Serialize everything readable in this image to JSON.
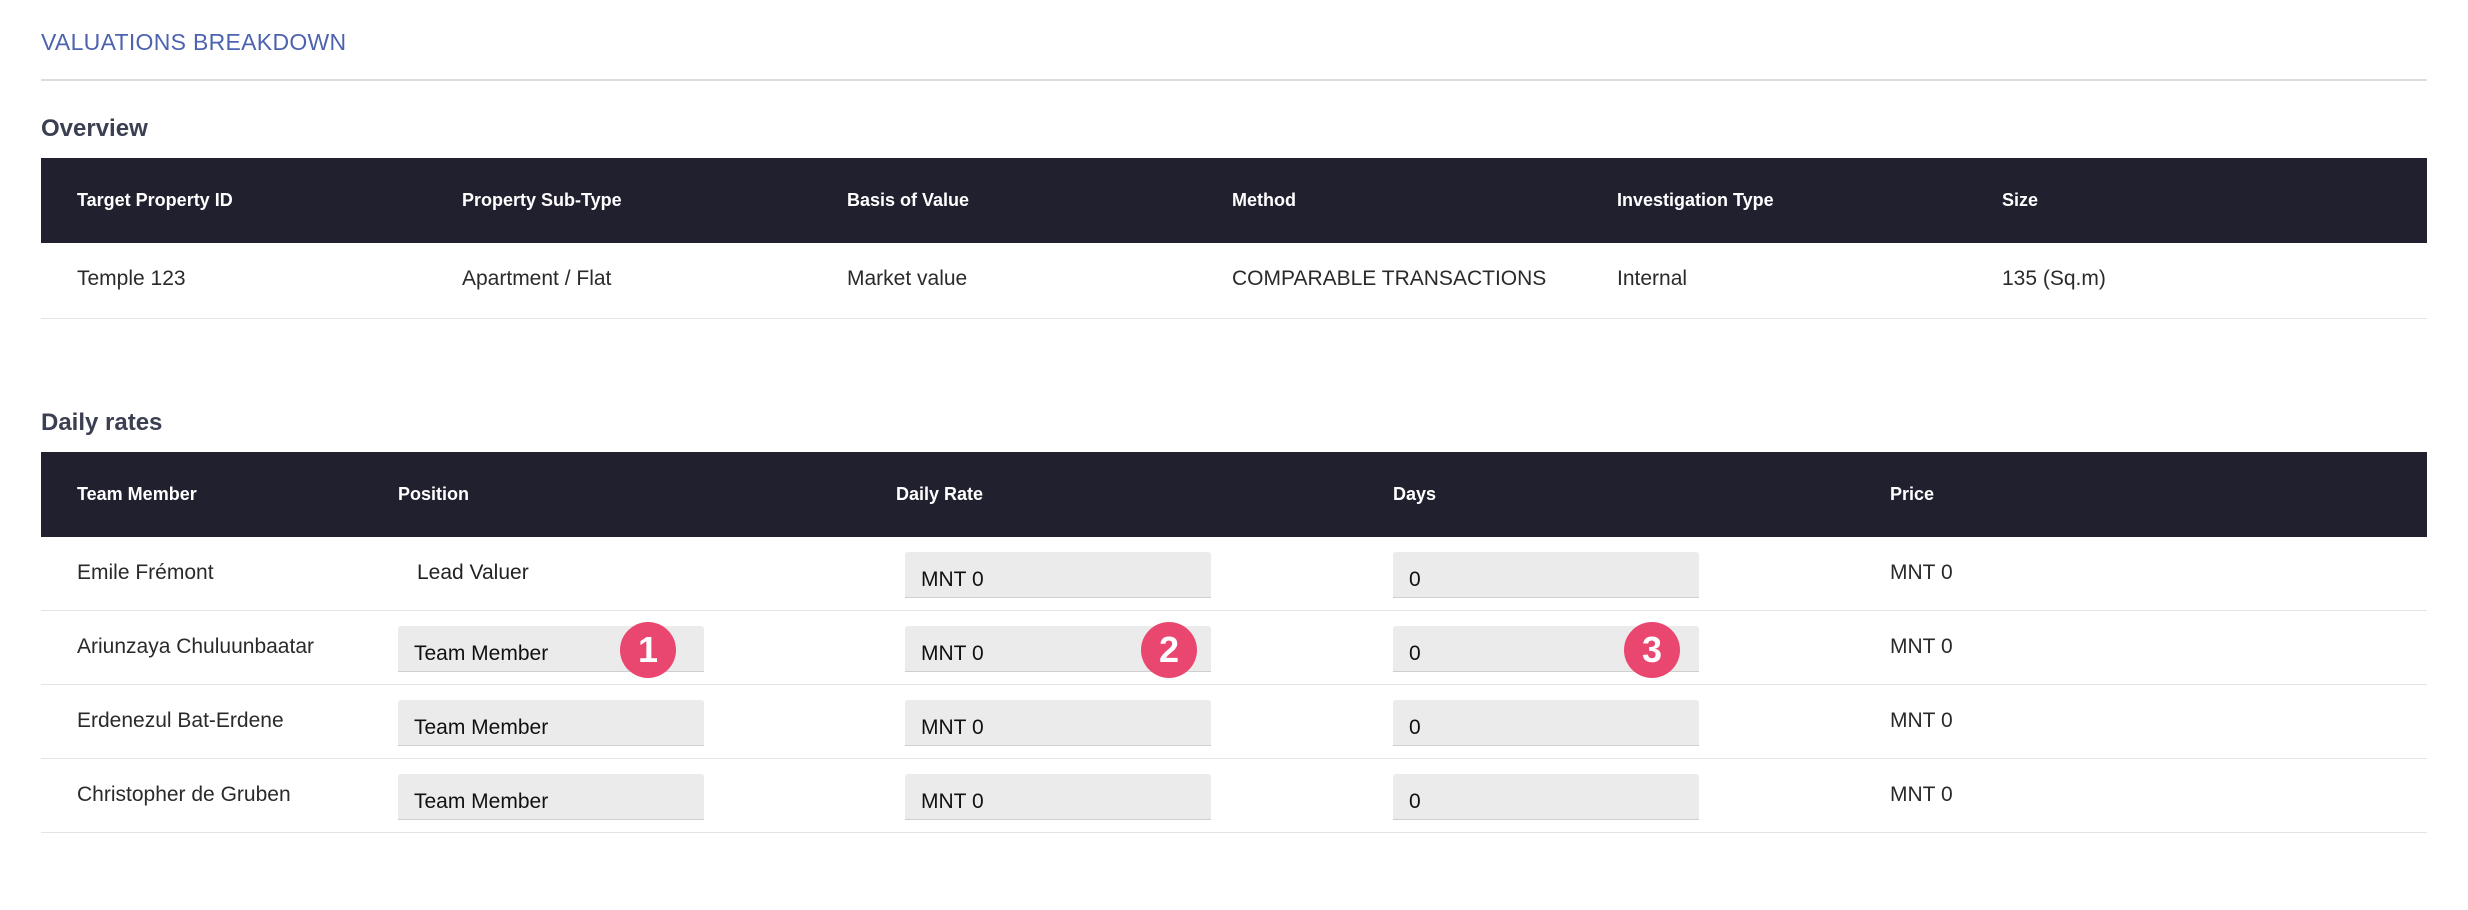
{
  "page_title": "VALUATIONS BREAKDOWN",
  "overview": {
    "title": "Overview",
    "headers": [
      "Target Property ID",
      "Property Sub-Type",
      "Basis of Value",
      "Method",
      "Investigation Type",
      "Size"
    ],
    "row": [
      "Temple 123",
      "Apartment / Flat",
      "Market value",
      "COMPARABLE TRANSACTIONS",
      "Internal",
      "135 (Sq.m)"
    ]
  },
  "daily_rates": {
    "title": "Daily rates",
    "headers": [
      "Team Member",
      "Position",
      "Daily Rate",
      "Days",
      "Price"
    ],
    "rows": [
      {
        "member": "Emile Frémont",
        "position": "Lead Valuer",
        "position_editable": false,
        "rate": "MNT 0",
        "days": "0",
        "price": "MNT 0"
      },
      {
        "member": "Ariunzaya Chuluunbaatar",
        "position": "Team Member",
        "position_editable": true,
        "rate": "MNT 0",
        "days": "0",
        "price": "MNT 0"
      },
      {
        "member": "Erdenezul Bat-Erdene",
        "position": "Team Member",
        "position_editable": true,
        "rate": "MNT 0",
        "days": "0",
        "price": "MNT 0"
      },
      {
        "member": "Christopher de Gruben",
        "position": "Team Member",
        "position_editable": true,
        "rate": "MNT 0",
        "days": "0",
        "price": "MNT 0"
      }
    ]
  },
  "callouts": [
    "1",
    "2",
    "3"
  ],
  "colors": {
    "title": "#4d63b0",
    "header_bg": "#21202f",
    "badge": "#e94670",
    "field_bg": "#ebebeb"
  }
}
